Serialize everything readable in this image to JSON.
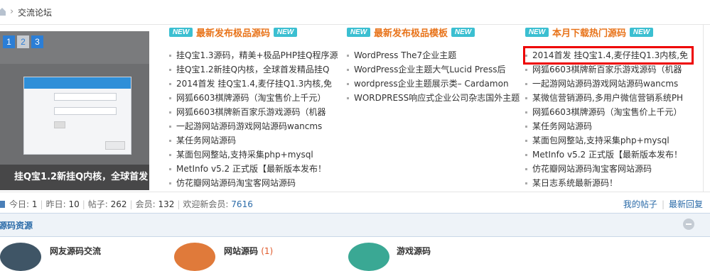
{
  "breadcrumb": {
    "home_icon": "home-icon",
    "separator": "›",
    "current": "交流论坛"
  },
  "slideshow": {
    "pages": [
      "1",
      "2",
      "3"
    ],
    "active_page": "2",
    "caption": "挂Q宝1.2新挂Q内核，全球首发"
  },
  "columns": [
    {
      "badge": "NEW",
      "title": "最新发布极品源码",
      "items": [
        "挂Q宝1.3源码，精美+极品PHP挂Q程序源",
        "挂Q宝1.2新挂Q内核，全球首发精品挂Q",
        "2014首发 挂Q宝1.4,麦仔挂Q1.3内核,免",
        "网狐6603棋牌源码（淘宝售价上千元）",
        "网狐6603棋牌新百家乐游戏源码（机器",
        "一起游网站源码游戏网站源码wancms",
        "某任务网站源码",
        "某面包网整站,支持采集php+mysql",
        "MetInfo v5.2 正式版【最新版本发布！",
        "仿花瓣网站源码淘宝客网站源码"
      ]
    },
    {
      "badge": "NEW",
      "title": "最新发布极品模板",
      "items": [
        "WordPress The7企业主题",
        "WordPress企业主题大气Lucid Press后",
        "wordpress企业主题展示类– Cardamon",
        "WORDPRESS响应式企业公司杂志国外主题"
      ]
    },
    {
      "badge": "NEW",
      "title": "本月下载热门源码",
      "items": [
        "2014首发 挂Q宝1.4,麦仔挂Q1.3内核,免",
        "网狐6603棋牌新百家乐游戏源码（机器",
        "一起游网站源码游戏网站源码wancms",
        "某微信营销源码,多用户微信营销系统PH",
        "网狐6603棋牌源码（淘宝售价上千元）",
        "某任务网站源码",
        "某面包网整站,支持采集php+mysql",
        "MetInfo v5.2 正式版【最新版本发布！",
        "仿花瓣网站源码淘宝客网站源码",
        "某日志系统最新源码！"
      ]
    }
  ],
  "stats": {
    "today_label": "今日:",
    "today": "1",
    "yesterday_label": "昨日:",
    "yesterday": "10",
    "posts_label": "帖子:",
    "posts": "262",
    "members_label": "会员:",
    "members": "132",
    "welcome_label": "欢迎新会员:",
    "new_member": "7616",
    "my_posts": "我的帖子",
    "latest_replies": "最新回复"
  },
  "section": {
    "title": "源码资源"
  },
  "forums": [
    {
      "name": "网友源码交流",
      "count": "",
      "icon_color": "#3f5566"
    },
    {
      "name": "网站源码",
      "count": "(1)",
      "icon_color": "#e07a3a"
    },
    {
      "name": "游戏源码",
      "count": "",
      "icon_color": "#3aa894"
    }
  ],
  "colors": {
    "accent_blue": "#2b6ba8",
    "title_orange": "#e8741b",
    "badge_cyan": "#3bbfd1",
    "highlight_red": "#e00000"
  }
}
